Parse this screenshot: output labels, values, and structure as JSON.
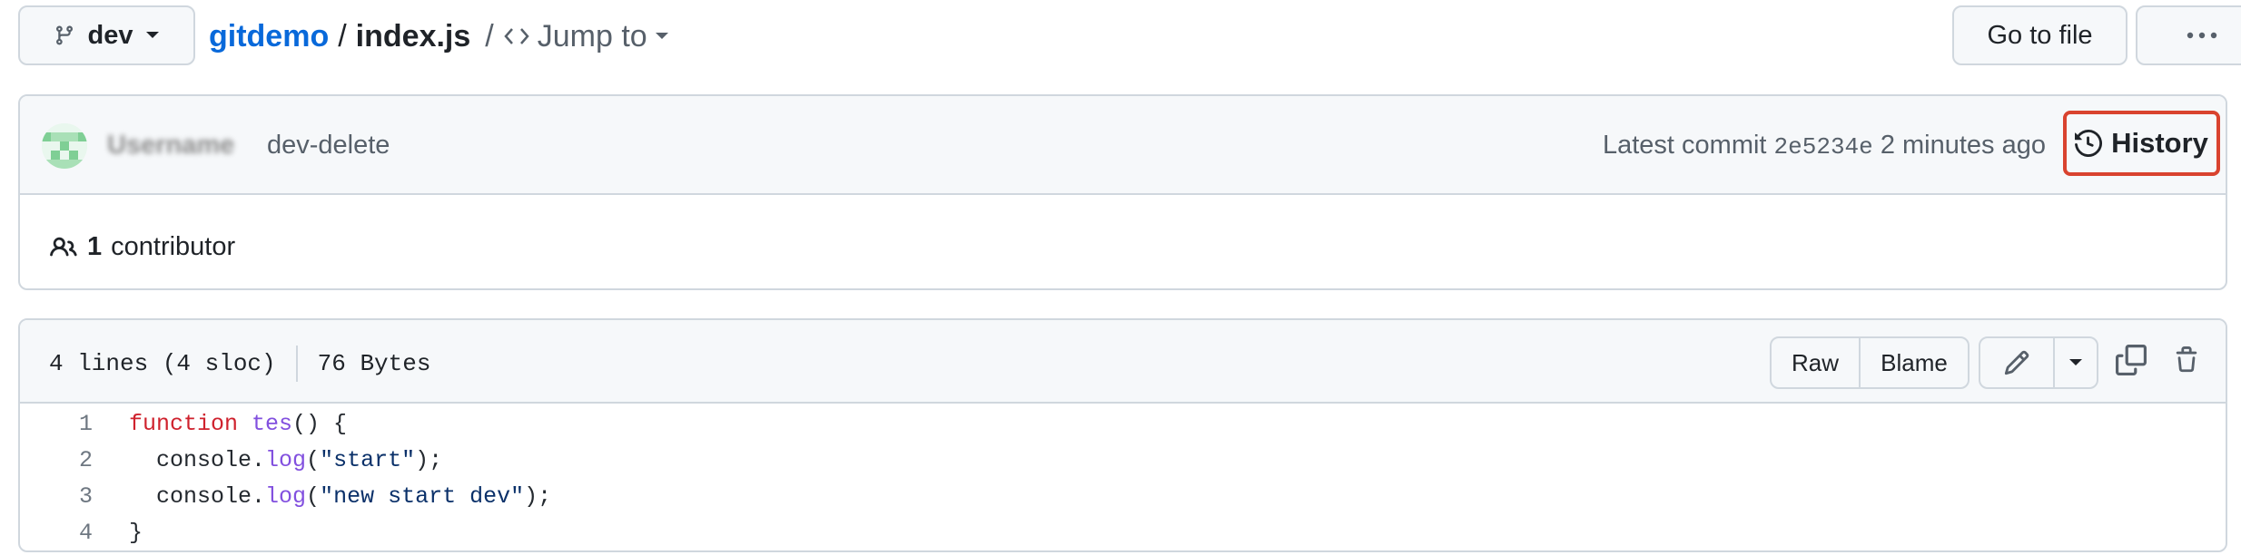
{
  "branch": {
    "label": "dev"
  },
  "breadcrumb": {
    "repo": "gitdemo",
    "separator": "/",
    "file": "index.js",
    "separator2": "/",
    "jump_label": "Jump to"
  },
  "header_actions": {
    "go_to_file": "Go to file",
    "more": "More options"
  },
  "commit": {
    "author": "Username",
    "message": "dev-delete",
    "latest_prefix": "Latest commit",
    "sha": "2e5234e",
    "time": "2 minutes ago",
    "history_label": "History"
  },
  "contributors": {
    "count": "1",
    "label": "contributor"
  },
  "file": {
    "lines_info": "4 lines (4 sloc)",
    "size": "76 Bytes",
    "raw_label": "Raw",
    "blame_label": "Blame"
  },
  "code_lines": [
    {
      "num": "1",
      "tokens": [
        {
          "t": "function ",
          "c": "kw"
        },
        {
          "t": "tes",
          "c": "fn"
        },
        {
          "t": "() {",
          "c": ""
        }
      ]
    },
    {
      "num": "2",
      "tokens": [
        {
          "t": "  console.",
          "c": ""
        },
        {
          "t": "log",
          "c": "fn"
        },
        {
          "t": "(",
          "c": ""
        },
        {
          "t": "\"start\"",
          "c": "str"
        },
        {
          "t": ");",
          "c": ""
        }
      ]
    },
    {
      "num": "3",
      "tokens": [
        {
          "t": "  console.",
          "c": ""
        },
        {
          "t": "log",
          "c": "fn"
        },
        {
          "t": "(",
          "c": ""
        },
        {
          "t": "\"new start dev\"",
          "c": "str"
        },
        {
          "t": ");",
          "c": ""
        }
      ]
    },
    {
      "num": "4",
      "tokens": [
        {
          "t": "}",
          "c": ""
        }
      ]
    }
  ],
  "colors": {
    "link": "#0969da",
    "highlight_border": "#d9432f",
    "keyword": "#cf222e",
    "function": "#8250df",
    "string": "#0a3069"
  },
  "icons": [
    "git-branch-icon",
    "chevron-down-icon",
    "code-icon",
    "kebab-horizontal-icon",
    "history-icon",
    "people-icon",
    "pencil-icon",
    "copy-icon",
    "trash-icon"
  ]
}
